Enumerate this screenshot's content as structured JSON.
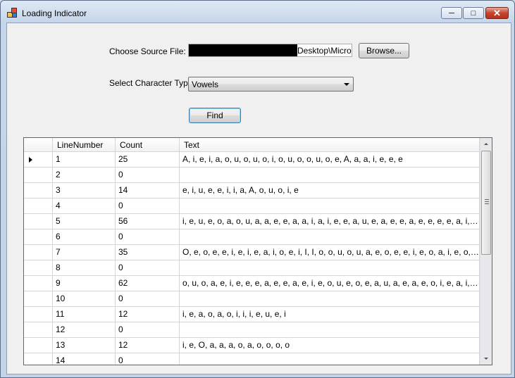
{
  "window": {
    "title": "Loading Indicator"
  },
  "form": {
    "source_label": "Choose Source File:",
    "source_path_visible": "Desktop\\Microsoft",
    "browse_label": "Browse...",
    "char_type_label": "Select Character Type:",
    "char_type_value": "Vowels",
    "find_label": "Find"
  },
  "grid": {
    "columns": [
      "LineNumber",
      "Count",
      "Text"
    ],
    "rows": [
      {
        "line": "1",
        "count": "25",
        "text": "A, i, e, i, a, o, u, o, u, o, i, o, u, o, o, u, o, e, A, a, a, i, e, e, e"
      },
      {
        "line": "2",
        "count": "0",
        "text": ""
      },
      {
        "line": "3",
        "count": "14",
        "text": "e, i, u, e, e, i, i, a, A, o, u, o, i, e"
      },
      {
        "line": "4",
        "count": "0",
        "text": ""
      },
      {
        "line": "5",
        "count": "56",
        "text": "i, e, u, e, o, a, o, u, a, a, e, e, a, a, i, a, i, e, e, a, u, e, a, e, e, a, e, e, e, e, a, i, a, a, e, e, ..."
      },
      {
        "line": "6",
        "count": "0",
        "text": ""
      },
      {
        "line": "7",
        "count": "35",
        "text": "O, e, o, e, e, i, e, i, e, a, i, o, e, i, I, I, o, o, u, o, u, a, e, o, e, e, i, e, o, a, i, e, o, e, a"
      },
      {
        "line": "8",
        "count": "0",
        "text": ""
      },
      {
        "line": "9",
        "count": "62",
        "text": "o, u, o, a, e, i, e, e, e, a, e, e, a, e, i, e, o, u, e, o, e, a, u, a, e, a, e, o, i, e, a, i, o, o, i, i,..."
      },
      {
        "line": "10",
        "count": "0",
        "text": ""
      },
      {
        "line": "11",
        "count": "12",
        "text": "i, e, a, o, a, o, i, i, i, e, u, e, i"
      },
      {
        "line": "12",
        "count": "0",
        "text": ""
      },
      {
        "line": "13",
        "count": "12",
        "text": "i, e, O, a, a, a, o, a, o, o, o, o"
      },
      {
        "line": "14",
        "count": "0",
        "text": ""
      }
    ]
  }
}
